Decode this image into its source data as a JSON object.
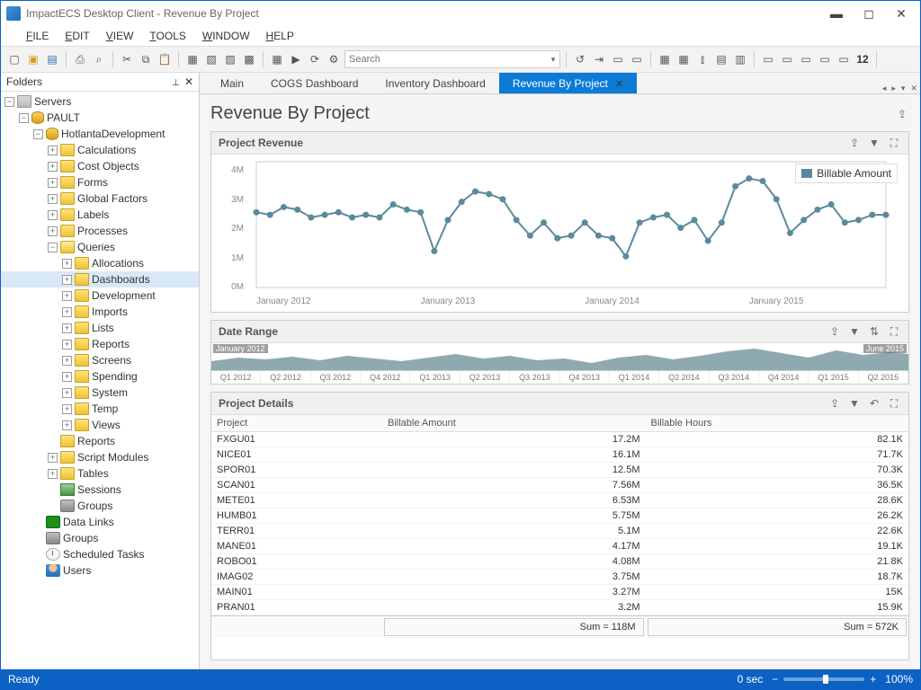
{
  "app": {
    "title": "ImpactECS Desktop Client - Revenue By Project"
  },
  "menus": [
    "FILE",
    "EDIT",
    "VIEW",
    "TOOLS",
    "WINDOW",
    "HELP"
  ],
  "search": {
    "placeholder": "Search"
  },
  "foldersPanel": {
    "title": "Folders"
  },
  "tree": {
    "root": "Servers",
    "server": "PAULT",
    "db": "HotlantaDevelopment",
    "dbChildren": [
      "Calculations",
      "Cost Objects",
      "Forms",
      "Global Factors",
      "Labels",
      "Processes"
    ],
    "queries": "Queries",
    "queryChildren": [
      "Allocations",
      "Dashboards",
      "Development",
      "Imports",
      "Lists",
      "Reports",
      "Screens",
      "Spending",
      "System",
      "Temp",
      "Views"
    ],
    "afterQueries": [
      "Reports",
      "Script Modules",
      "Tables",
      "Sessions",
      "Groups"
    ],
    "serverChildren": [
      "Data Links",
      "Groups",
      "Scheduled Tasks",
      "Users"
    ],
    "selected": "Dashboards"
  },
  "tabs": [
    {
      "label": "Main",
      "active": false
    },
    {
      "label": "COGS Dashboard",
      "active": false
    },
    {
      "label": "Inventory Dashboard",
      "active": false
    },
    {
      "label": "Revenue By Project",
      "active": true
    }
  ],
  "page": {
    "title": "Revenue By Project"
  },
  "revenuePanel": {
    "title": "Project Revenue",
    "legend": "Billable Amount"
  },
  "rangePanel": {
    "title": "Date Range",
    "start": "January 2012",
    "end": "June 2015",
    "ticks": [
      "Q1 2012",
      "Q2 2012",
      "Q3 2012",
      "Q4 2012",
      "Q1 2013",
      "Q2 2013",
      "Q3 2013",
      "Q4 2013",
      "Q1 2014",
      "Q2 2014",
      "Q3 2014",
      "Q4 2014",
      "Q1 2015",
      "Q2 2015"
    ]
  },
  "detailsPanel": {
    "title": "Project Details",
    "cols": [
      "Project",
      "Billable Amount",
      "Billable Hours"
    ],
    "rows": [
      {
        "p": "FXGU01",
        "a": "17.2M",
        "h": "82.1K"
      },
      {
        "p": "NICE01",
        "a": "16.1M",
        "h": "71.7K"
      },
      {
        "p": "SPOR01",
        "a": "12.5M",
        "h": "70.3K"
      },
      {
        "p": "SCAN01",
        "a": "7.56M",
        "h": "36.5K"
      },
      {
        "p": "METE01",
        "a": "6.53M",
        "h": "28.6K"
      },
      {
        "p": "HUMB01",
        "a": "5.75M",
        "h": "26.2K"
      },
      {
        "p": "TERR01",
        "a": "5.1M",
        "h": "22.6K"
      },
      {
        "p": "MANE01",
        "a": "4.17M",
        "h": "19.1K"
      },
      {
        "p": "ROBO01",
        "a": "4.08M",
        "h": "21.8K"
      },
      {
        "p": "IMAG02",
        "a": "3.75M",
        "h": "18.7K"
      },
      {
        "p": "MAIN01",
        "a": "3.27M",
        "h": "15K"
      },
      {
        "p": "PRAN01",
        "a": "3.2M",
        "h": "15.9K"
      }
    ],
    "sumA": "Sum = 118M",
    "sumH": "Sum = 572K"
  },
  "status": {
    "ready": "Ready",
    "time": "0 sec",
    "zoom": "100%"
  },
  "chart_data": {
    "type": "line",
    "title": "Project Revenue",
    "ylabel": "Billable Amount",
    "ylim": [
      0,
      4.5
    ],
    "yticks": [
      "0M",
      "1M",
      "2M",
      "3M",
      "4M"
    ],
    "xticks": [
      "January 2012",
      "January 2013",
      "January 2014",
      "January 2015"
    ],
    "x_months_from_jan2012": [
      0,
      1,
      2,
      3,
      4,
      5,
      6,
      7,
      8,
      9,
      10,
      11,
      12,
      13,
      14,
      15,
      16,
      17,
      18,
      19,
      20,
      21,
      22,
      23,
      24,
      25,
      26,
      27,
      28,
      29,
      30,
      31,
      32,
      33,
      34,
      35,
      36,
      37,
      38,
      39,
      40,
      41
    ],
    "values_millions": [
      2.9,
      2.8,
      3.1,
      3.0,
      2.7,
      2.8,
      2.9,
      2.7,
      2.8,
      2.7,
      3.2,
      3.0,
      2.9,
      1.4,
      2.6,
      3.3,
      3.7,
      3.6,
      3.4,
      2.6,
      2.0,
      2.5,
      1.9,
      2.0,
      2.5,
      2.0,
      1.9,
      1.2,
      2.5,
      2.7,
      2.8,
      2.3,
      2.6,
      1.8,
      2.5,
      3.9,
      4.2,
      4.1,
      3.4,
      2.1,
      2.6,
      3.0
    ],
    "values_end": [
      3.2,
      2.5,
      2.6,
      2.8,
      2.8
    ]
  }
}
